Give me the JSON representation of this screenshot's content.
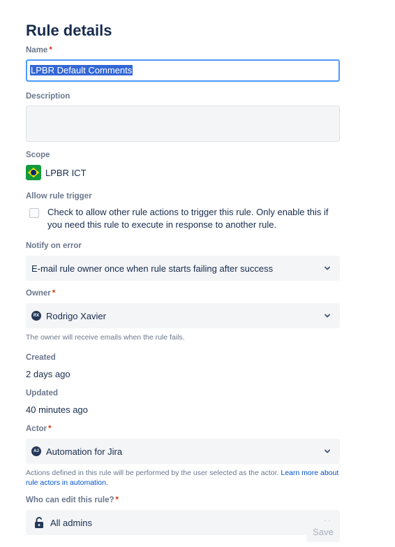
{
  "title": "Rule details",
  "name": {
    "label": "Name",
    "required": "*",
    "value": "LPBR Default Comments"
  },
  "description": {
    "label": "Description",
    "value": ""
  },
  "scope": {
    "label": "Scope",
    "icon": "brazil-flag-icon",
    "value": "LPBR ICT"
  },
  "allow_trigger": {
    "label": "Allow rule trigger",
    "checked": false,
    "text": "Check to allow other rule actions to trigger this rule. Only enable this if you need this rule to execute in response to another rule."
  },
  "notify": {
    "label": "Notify on error",
    "value": "E-mail rule owner once when rule starts failing after success"
  },
  "owner": {
    "label": "Owner",
    "required": "*",
    "avatar_initials": "RX",
    "value": "Rodrigo Xavier",
    "help": "The owner will receive emails when the rule fails."
  },
  "created": {
    "label": "Created",
    "value": "2 days ago"
  },
  "updated": {
    "label": "Updated",
    "value": "40 minutes ago"
  },
  "actor": {
    "label": "Actor",
    "required": "*",
    "avatar_initials": "AJ",
    "value": "Automation for Jira",
    "help": "Actions defined in this rule will be performed by the user selected as the actor.",
    "help_link": "Learn more about rule actors in automation."
  },
  "who_can_edit": {
    "label": "Who can edit this rule?",
    "required": "*",
    "icon": "lock-icon",
    "value": "All admins"
  },
  "save_label": "Save",
  "colors": {
    "accent": "#0052cc",
    "focus": "#4c9aff",
    "required": "#de350b",
    "field_bg": "#f4f5f7"
  }
}
